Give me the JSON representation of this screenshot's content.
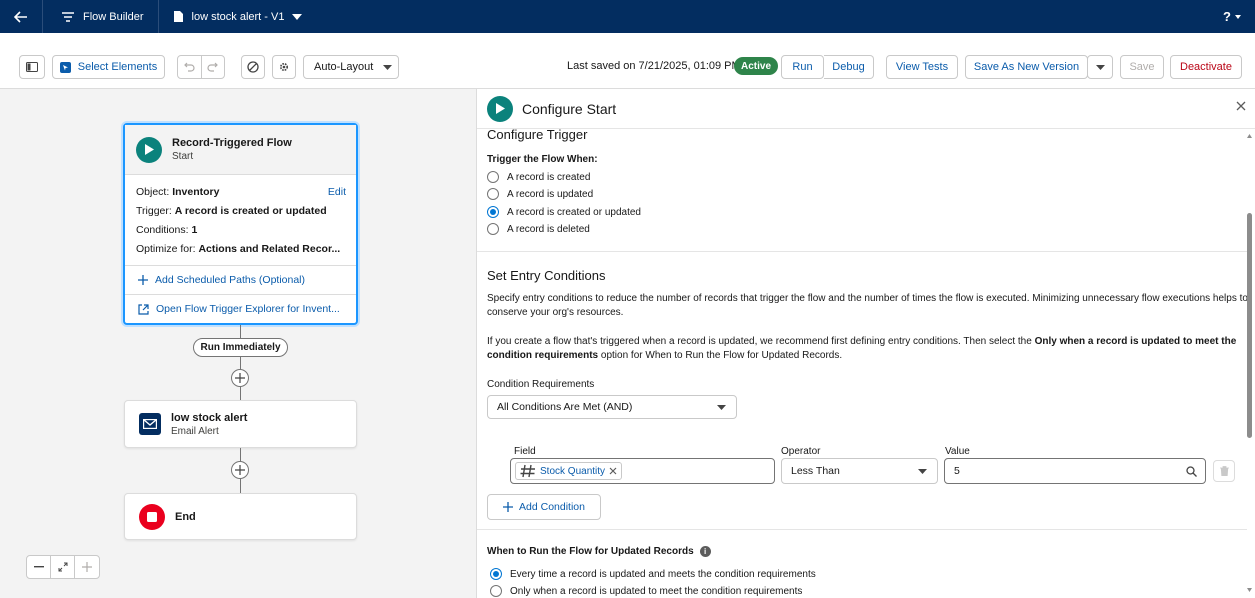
{
  "topbar": {
    "app_name": "Flow Builder",
    "flow_tab": "low stock alert - V1",
    "help": "?"
  },
  "toolbar": {
    "select_elements": "Select Elements",
    "layout_mode": "Auto-Layout",
    "last_saved": "Last saved on 7/21/2025, 01:09 PM",
    "status": "Active",
    "run": "Run",
    "debug": "Debug",
    "view_tests": "View Tests",
    "save_new_version": "Save As New Version",
    "save": "Save",
    "deactivate": "Deactivate"
  },
  "canvas": {
    "start": {
      "title": "Record-Triggered Flow",
      "subtitle": "Start",
      "object_label": "Object:",
      "object_value": "Inventory",
      "edit": "Edit",
      "trigger_label": "Trigger:",
      "trigger_value": "A record is created or updated",
      "conditions_label": "Conditions:",
      "conditions_value": "1",
      "optimize_label": "Optimize for:",
      "optimize_value": "Actions and Related Recor...",
      "add_scheduled": "Add Scheduled Paths (Optional)",
      "open_explorer": "Open Flow Trigger Explorer for Invent..."
    },
    "run_immediately": "Run Immediately",
    "email_node": {
      "title": "low stock alert",
      "subtitle": "Email Alert"
    },
    "end_node": {
      "title": "End"
    }
  },
  "panel": {
    "title": "Configure Start",
    "configure_trigger": "Configure Trigger",
    "trigger_when": "Trigger the Flow When:",
    "trigger_options": [
      {
        "label": "A record is created",
        "selected": false
      },
      {
        "label": "A record is updated",
        "selected": false
      },
      {
        "label": "A record is created or updated",
        "selected": true
      },
      {
        "label": "A record is deleted",
        "selected": false
      }
    ],
    "entry_title": "Set Entry Conditions",
    "entry_desc_1": "Specify entry conditions to reduce the number of records that trigger the flow and the number of times the flow is executed. Minimizing unnecessary flow executions helps to",
    "entry_desc_2": "conserve your org's resources.",
    "entry_tip_1_a": "If you create a flow that's triggered when a record is updated, we recommend first defining entry conditions. Then select the ",
    "entry_tip_1_b": "Only when a record is updated to meet the",
    "entry_tip_2_a": "condition requirements",
    "entry_tip_2_b": " option for When to Run the Flow for Updated Records.",
    "condition_req_label": "Condition Requirements",
    "condition_req_value": "All Conditions Are Met (AND)",
    "field_label": "Field",
    "operator_label": "Operator",
    "value_label": "Value",
    "field_value": "Stock Quantity",
    "operator_value": "Less Than",
    "value_value": "5",
    "add_condition": "Add Condition",
    "when_run_title": "When to Run the Flow for Updated Records",
    "when_run_options": [
      {
        "label": "Every time a record is updated and meets the condition requirements",
        "selected": true
      },
      {
        "label": "Only when a record is updated to meet the condition requirements",
        "selected": false
      }
    ]
  },
  "colors": {
    "topbar": "#032d60",
    "brand_blue": "#0b5cab",
    "active_green": "#2e844a",
    "start_teal": "#0b827c",
    "end_red": "#ea001e"
  }
}
